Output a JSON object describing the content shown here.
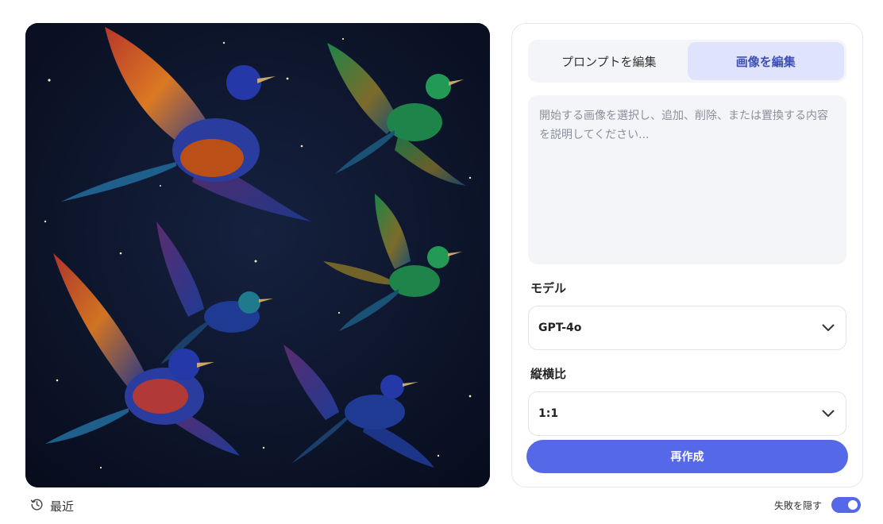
{
  "image": {
    "description_icon": "generated-image"
  },
  "tabs": [
    {
      "label": "プロンプトを編集",
      "active": false
    },
    {
      "label": "画像を編集",
      "active": true
    }
  ],
  "prompt": {
    "placeholder": "開始する画像を選択し、追加、削除、または置換する内容を説明してください...",
    "value": ""
  },
  "model": {
    "label": "モデル",
    "selected": "GPT-4o"
  },
  "aspect": {
    "label": "縦横比",
    "selected": "1:1"
  },
  "regenerate_label": "再作成",
  "footer": {
    "recent_label": "最近",
    "hide_failed_label": "失敗を隠す",
    "hide_failed_on": true
  },
  "colors": {
    "accent": "#5468e8",
    "tab_active_bg": "#dfe3fb"
  }
}
